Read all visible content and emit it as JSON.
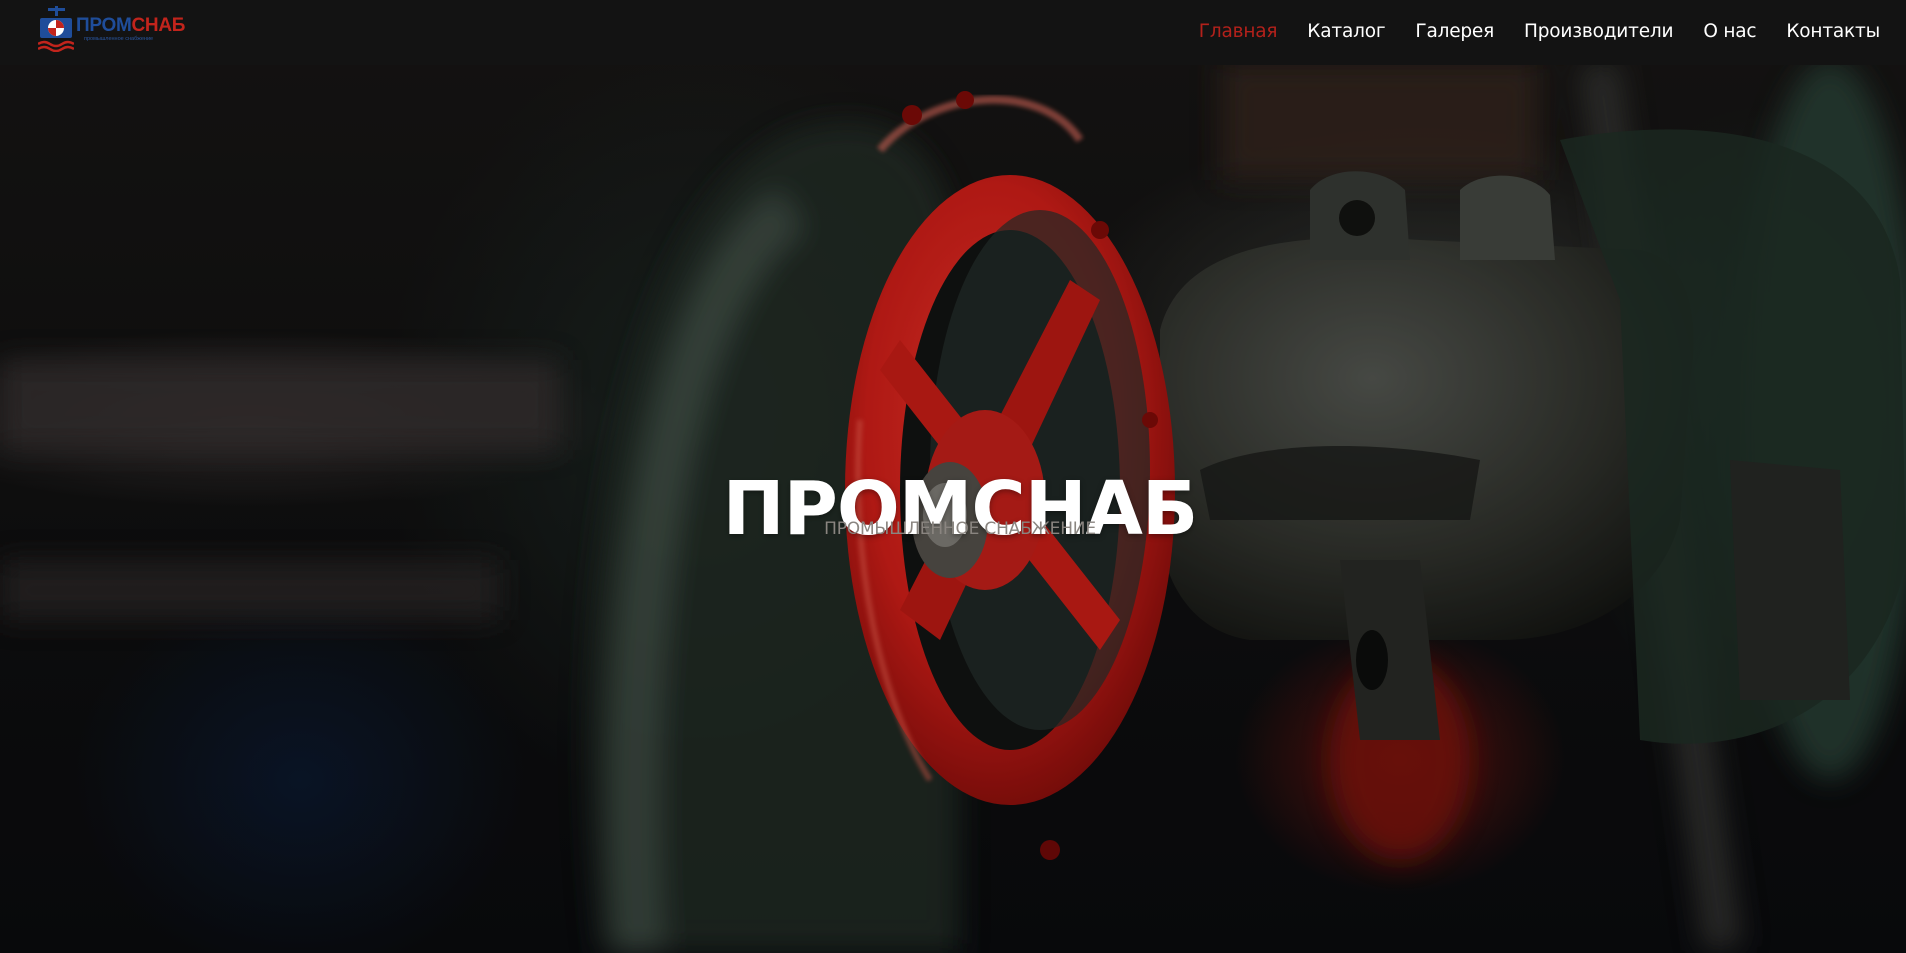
{
  "brand": {
    "logo_name_part1": "ПРОМ",
    "logo_name_part2": "СНАБ",
    "logo_tagline": "промышленное снабжение",
    "colors": {
      "blue": "#1f4d9a",
      "red": "#c2241c"
    }
  },
  "nav": {
    "items": [
      {
        "label": "Главная",
        "active": true
      },
      {
        "label": "Каталог"
      },
      {
        "label": "Галерея"
      },
      {
        "label": "Производители"
      },
      {
        "label": "О нас"
      },
      {
        "label": "Контакты"
      }
    ],
    "active_color": "#b3211b"
  },
  "hero": {
    "title": "ПРОМСНАБ",
    "subtitle": "ПРОМЫШЛЕННОЕ СНАБЖЕНИЕ",
    "background_image": "red-valve-handwheel-photo"
  }
}
